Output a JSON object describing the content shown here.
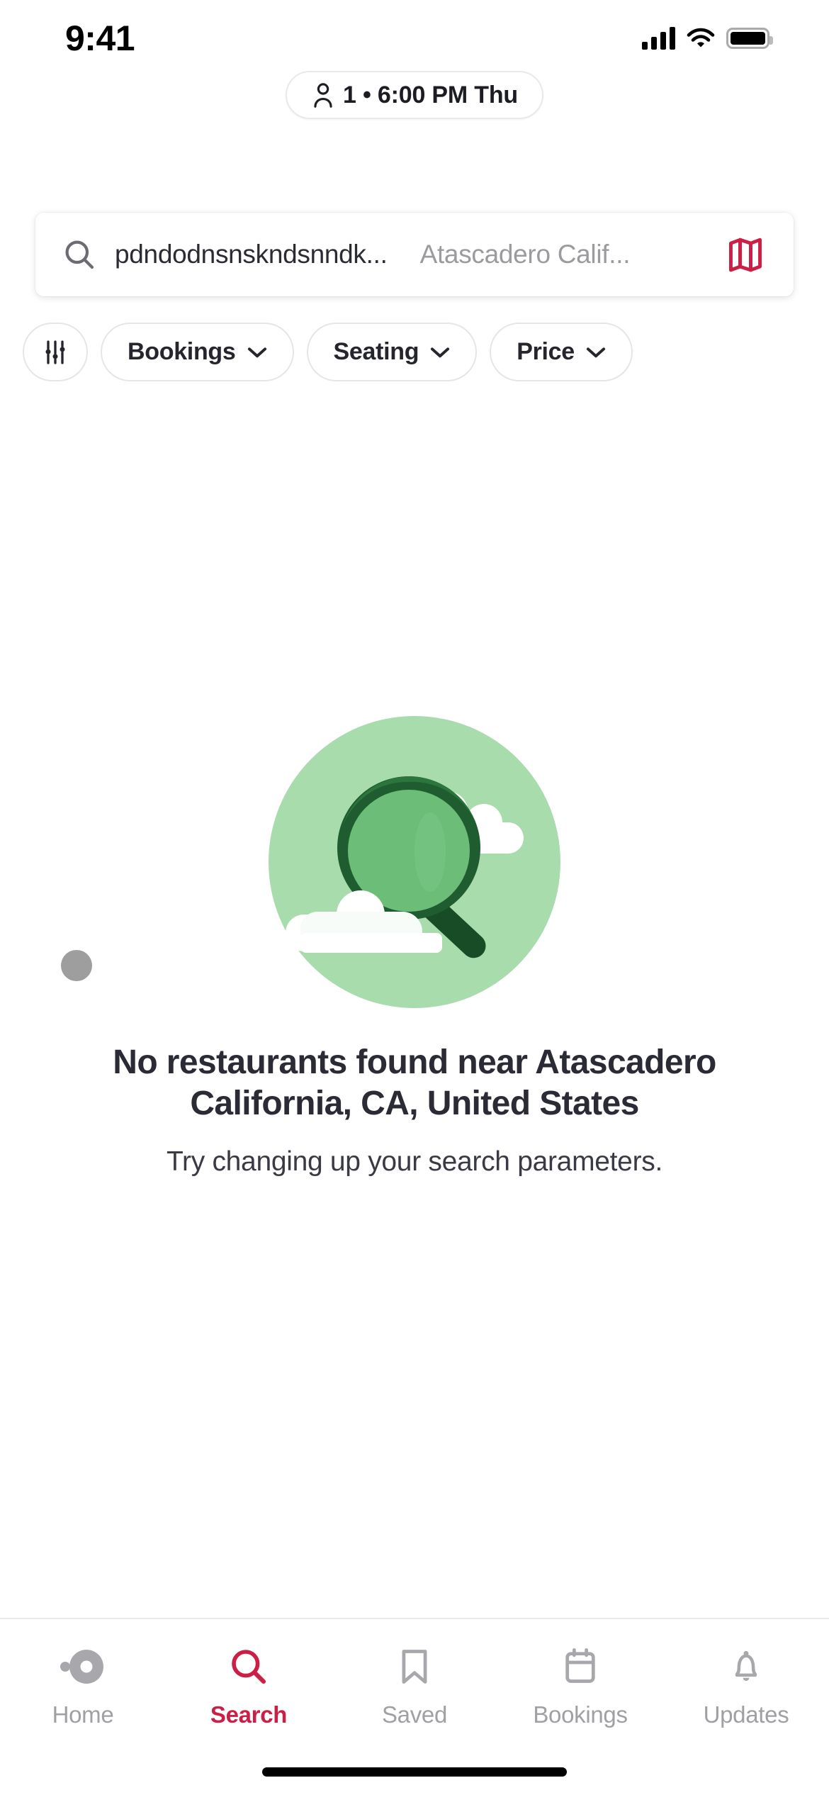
{
  "status_bar": {
    "time": "9:41",
    "cellular_icon": "signal-bars-icon",
    "wifi_icon": "wifi-icon",
    "battery_icon": "battery-full-icon"
  },
  "party_pill": {
    "person_icon": "person-icon",
    "text": "1 • 6:00 PM Thu"
  },
  "search": {
    "search_icon": "search-icon",
    "query": "pdndodnsnskndsnndk...",
    "location_placeholder": "Atascadero Calif...",
    "map_icon": "map-icon",
    "map_icon_color": "#cc1f45"
  },
  "filters": {
    "filter_icon": "sliders-icon",
    "chips": [
      {
        "label": "Bookings",
        "chevron": "chevron-down-icon"
      },
      {
        "label": "Seating",
        "chevron": "chevron-down-icon"
      },
      {
        "label": "Price",
        "chevron": "chevron-down-icon"
      }
    ]
  },
  "empty_state": {
    "illustration": "magnifying-glass-clouds-illustration",
    "circle_color": "#a8dcac",
    "glass_dark_color": "#1f5c30",
    "glass_lens_color": "#6cbd77",
    "cloud_color": "#ffffff",
    "dot_color": "#9e9e9e",
    "title": "No restaurants found near Atascadero California, CA, United States",
    "subtitle": "Try changing up your search parameters."
  },
  "tab_bar": {
    "active_color": "#cc1f45",
    "inactive_color": "#a0a0a4",
    "items": [
      {
        "label": "Home",
        "icon": "home-dot-icon",
        "active": false
      },
      {
        "label": "Search",
        "icon": "search-icon",
        "active": true
      },
      {
        "label": "Saved",
        "icon": "bookmark-icon",
        "active": false
      },
      {
        "label": "Bookings",
        "icon": "calendar-icon",
        "active": false
      },
      {
        "label": "Updates",
        "icon": "bell-icon",
        "active": false
      }
    ]
  }
}
